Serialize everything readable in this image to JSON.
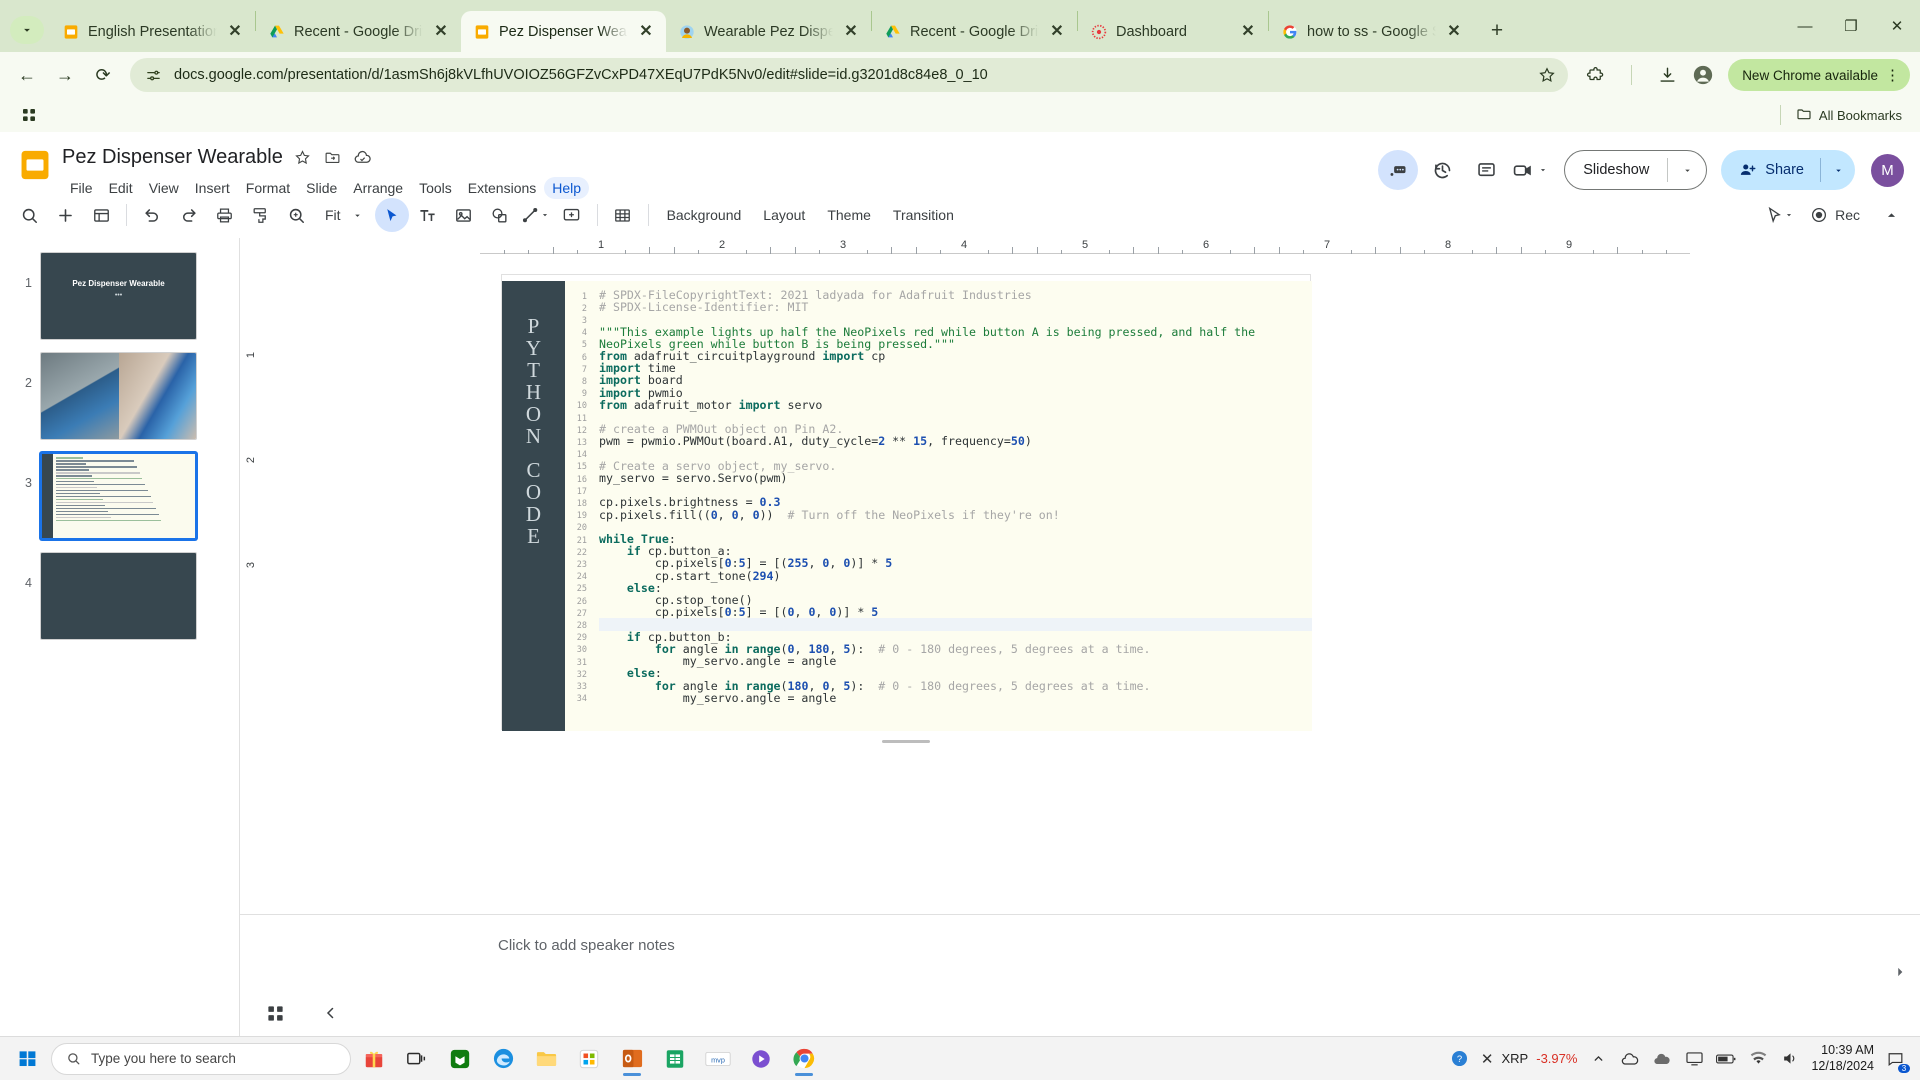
{
  "browser": {
    "tabs": [
      {
        "title": "English Presentation",
        "favicon": "slides-icon",
        "active": false
      },
      {
        "title": "Recent - Google Drive",
        "favicon": "drive-icon",
        "active": false
      },
      {
        "title": "Pez Dispenser Wearable",
        "favicon": "slides-icon",
        "active": true
      },
      {
        "title": "Wearable Pez Dispenser",
        "favicon": "adafruit-icon",
        "active": false
      },
      {
        "title": "Recent - Google Drive",
        "favicon": "drive-icon",
        "active": false
      },
      {
        "title": "Dashboard",
        "favicon": "canvas-icon",
        "active": false
      },
      {
        "title": "how to ss - Google S",
        "favicon": "google-icon",
        "active": false
      }
    ],
    "close_label": "✕",
    "new_tab_label": "+",
    "tab_search_label": "chevron-down",
    "window_controls": {
      "minimize": "—",
      "maximize": "❐",
      "close": "✕"
    },
    "omnibox": {
      "url": "docs.google.com/presentation/d/1asmSh6j8kVLfhUVOIOZ56GFZvCxPD47XEqU7PdK5Nv0/edit#slide=id.g3201d8c84e8_0_10",
      "placeholder": "Search Google or type a URL",
      "site_info_icon": "tune-icon",
      "bookmark_icon": "star-icon"
    },
    "back_label": "←",
    "forward_label": "→",
    "reload_label": "⟳",
    "extensions_icon": "puzzle-icon",
    "downloads_icon": "download-icon",
    "profile_icon": "profile-icon",
    "menu_icon": "kebab-icon",
    "update_chip": "New Chrome available",
    "bookmarks": {
      "apps_icon": "apps-grid-icon",
      "all_bookmarks": "All Bookmarks",
      "folder_icon": "folder-icon"
    }
  },
  "slides": {
    "doc_title": "Pez Dispenser Wearable",
    "title_icons": [
      "star-icon",
      "move-to-folder-icon",
      "cloud-saved-icon"
    ],
    "menus": [
      "File",
      "Edit",
      "View",
      "Insert",
      "Format",
      "Slide",
      "Arrange",
      "Tools",
      "Extensions",
      "Help"
    ],
    "highlighted_menu": "Help",
    "header_icons": [
      "meet-comment-icon",
      "version-history-icon",
      "comment-icon",
      "present-camera-icon"
    ],
    "slideshow_label": "Slideshow",
    "share_label": "Share",
    "user_initial": "M",
    "toolbar": {
      "search_icon": "search-icon",
      "add_slide_icon": "plus-icon",
      "layout_icon": "layout-icon",
      "undo_icon": "undo-icon",
      "redo_icon": "redo-icon",
      "print_icon": "print-icon",
      "paint_icon": "paint-format-icon",
      "zoom_icon": "zoom-icon",
      "zoom_value": "Fit",
      "select_icon": "cursor-icon",
      "textbox_icon": "text-box-icon",
      "image_icon": "image-icon",
      "shape_icon": "shape-icon",
      "line_icon": "line-icon",
      "comment_icon": "add-comment-icon",
      "table_icon": "table-icon",
      "background_label": "Background",
      "layout_label": "Layout",
      "theme_label": "Theme",
      "transition_label": "Transition",
      "pointer_icon": "laser-pointer-icon",
      "rec_label": "Rec",
      "collapse_icon": "chevron-up-icon"
    },
    "filmstrip": [
      {
        "num": "1",
        "type": "title",
        "title": "Pez Dispenser Wearable",
        "subtitle": "•••",
        "selected": false
      },
      {
        "num": "2",
        "type": "photos",
        "title": "",
        "subtitle": "",
        "selected": false
      },
      {
        "num": "3",
        "type": "code",
        "title": "",
        "subtitle": "",
        "selected": true
      },
      {
        "num": "4",
        "type": "blank",
        "title": "",
        "subtitle": "",
        "selected": false
      }
    ],
    "ruler": {
      "marks": [
        "1",
        "2",
        "3",
        "4",
        "5",
        "6",
        "7",
        "8",
        "9"
      ],
      "v_marks": [
        "1",
        "2",
        "3"
      ]
    },
    "notes_placeholder": "Click to add speaker notes",
    "bottom_icons": [
      "grid-view-icon",
      "chevron-left-icon"
    ],
    "notes_collapse_icon": "chevron-right-icon"
  },
  "slide_content": {
    "sidebar_letters": [
      "P",
      "Y",
      "T",
      "H",
      "O",
      "N",
      "",
      "C",
      "O",
      "D",
      "E"
    ],
    "code_lines": [
      {
        "n": "1",
        "text": "# SPDX-FileCopyrightText: 2021 ladyada for Adafruit Industries"
      },
      {
        "n": "2",
        "text": "# SPDX-License-Identifier: MIT"
      },
      {
        "n": "3",
        "text": ""
      },
      {
        "n": "4",
        "text": "\"\"\"This example lights up half the NeoPixels red while button A is being pressed, and half the"
      },
      {
        "n": "5",
        "text": "NeoPixels green while button B is being pressed.\"\"\""
      },
      {
        "n": "6",
        "text": "from adafruit_circuitplayground import cp"
      },
      {
        "n": "7",
        "text": "import time"
      },
      {
        "n": "8",
        "text": "import board"
      },
      {
        "n": "9",
        "text": "import pwmio"
      },
      {
        "n": "10",
        "text": "from adafruit_motor import servo"
      },
      {
        "n": "11",
        "text": ""
      },
      {
        "n": "12",
        "text": "# create a PWMOut object on Pin A2."
      },
      {
        "n": "13",
        "text": "pwm = pwmio.PWMOut(board.A1, duty_cycle=2 ** 15, frequency=50)"
      },
      {
        "n": "14",
        "text": ""
      },
      {
        "n": "15",
        "text": "# Create a servo object, my_servo."
      },
      {
        "n": "16",
        "text": "my_servo = servo.Servo(pwm)"
      },
      {
        "n": "17",
        "text": ""
      },
      {
        "n": "18",
        "text": "cp.pixels.brightness = 0.3"
      },
      {
        "n": "19",
        "text": "cp.pixels.fill((0, 0, 0))  # Turn off the NeoPixels if they're on!"
      },
      {
        "n": "20",
        "text": ""
      },
      {
        "n": "21",
        "text": "while True:"
      },
      {
        "n": "22",
        "text": "    if cp.button_a:"
      },
      {
        "n": "23",
        "text": "        cp.pixels[0:5] = [(255, 0, 0)] * 5"
      },
      {
        "n": "24",
        "text": "        cp.start_tone(294)"
      },
      {
        "n": "25",
        "text": "    else:"
      },
      {
        "n": "26",
        "text": "        cp.stop_tone()"
      },
      {
        "n": "27",
        "text": "        cp.pixels[0:5] = [(0, 0, 0)] * 5"
      },
      {
        "n": "28",
        "text": ""
      },
      {
        "n": "29",
        "text": "    if cp.button_b:"
      },
      {
        "n": "30",
        "text": "        for angle in range(0, 180, 5):  # 0 - 180 degrees, 5 degrees at a time."
      },
      {
        "n": "31",
        "text": "            my_servo.angle = angle"
      },
      {
        "n": "32",
        "text": "    else:"
      },
      {
        "n": "33",
        "text": "        for angle in range(180, 0, 5):  # 0 - 180 degrees, 5 degrees at a time."
      },
      {
        "n": "34",
        "text": "            my_servo.angle = angle"
      }
    ]
  },
  "taskbar": {
    "start_icon": "windows-icon",
    "search_placeholder": "Type you here to search",
    "search_text": "Type you here to search",
    "search_icon": "search-icon",
    "apps": [
      "gift-icon",
      "task-view-icon",
      "xbox-icon",
      "edge-icon",
      "file-explorer-icon",
      "store-icon",
      "outlook-icon",
      "sheets-icon",
      "mvp-icon",
      "media-icon",
      "chrome-icon"
    ],
    "tray": {
      "help_icon": "help-icon",
      "stock_symbol": "XRP",
      "stock_change": "-3.97%",
      "chevron_icon": "chevron-up-icon",
      "onedrive_icon": "onedrive-icon",
      "cloud_icon": "cloud-icon",
      "screen_icon": "screen-icon",
      "battery_icon": "battery-icon",
      "wifi_icon": "wifi-icon",
      "volume_icon": "volume-icon",
      "notification_count": "3",
      "time": "10:39 AM",
      "date": "12/18/2024"
    }
  },
  "colors": {
    "chrome_tabstrip": "#d9e7cd",
    "chrome_toolbar": "#f7faf2",
    "slides_accent": "#f9ab00",
    "share_bg": "#c2e7ff",
    "code_bg": "#fdfdf0",
    "code_sidebar": "#37474f",
    "selection_blue": "#1a73e8"
  }
}
